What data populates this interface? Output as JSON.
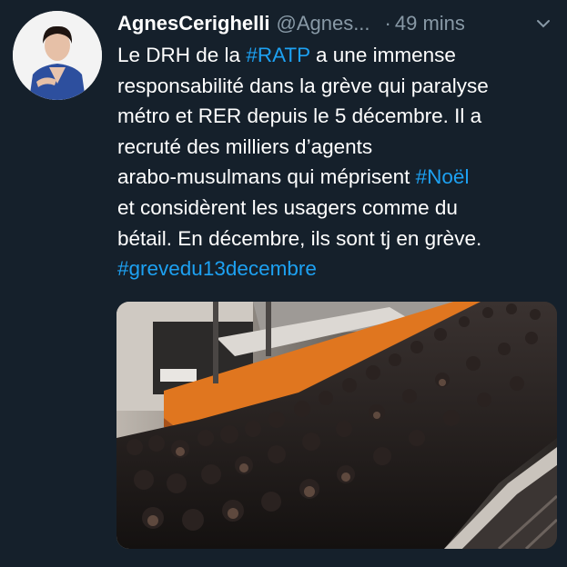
{
  "tweet": {
    "display_name": "AgnesCerighelli",
    "handle": "@Agnes...",
    "dot": "·",
    "time": "49 mins",
    "icons": {
      "menu": "chevron-down-icon",
      "avatar": "profile-photo"
    },
    "body": {
      "l1_a": "Le DRH de la ",
      "l1_tag": "#RATP",
      "l1_b": " a une immense",
      "l2": "responsabilité dans la grève qui paralyse",
      "l3": "métro et RER depuis le 5 décembre. Il a",
      "l4": "recruté des milliers d’agents",
      "l5_a": "arabo-musulmans qui méprisent ",
      "l5_tag": "#Noël",
      "l6": "et considèrent les usagers comme du",
      "l7": "bétail. En décembre, ils sont tj en grève.",
      "l8_tag": "#grevedu13decembre"
    },
    "media": {
      "kind": "photo",
      "subject": "crowded metro platform"
    }
  },
  "colors": {
    "background": "#15202b",
    "text": "#ffffff",
    "secondary": "#8899a6",
    "link": "#1da1f2"
  }
}
